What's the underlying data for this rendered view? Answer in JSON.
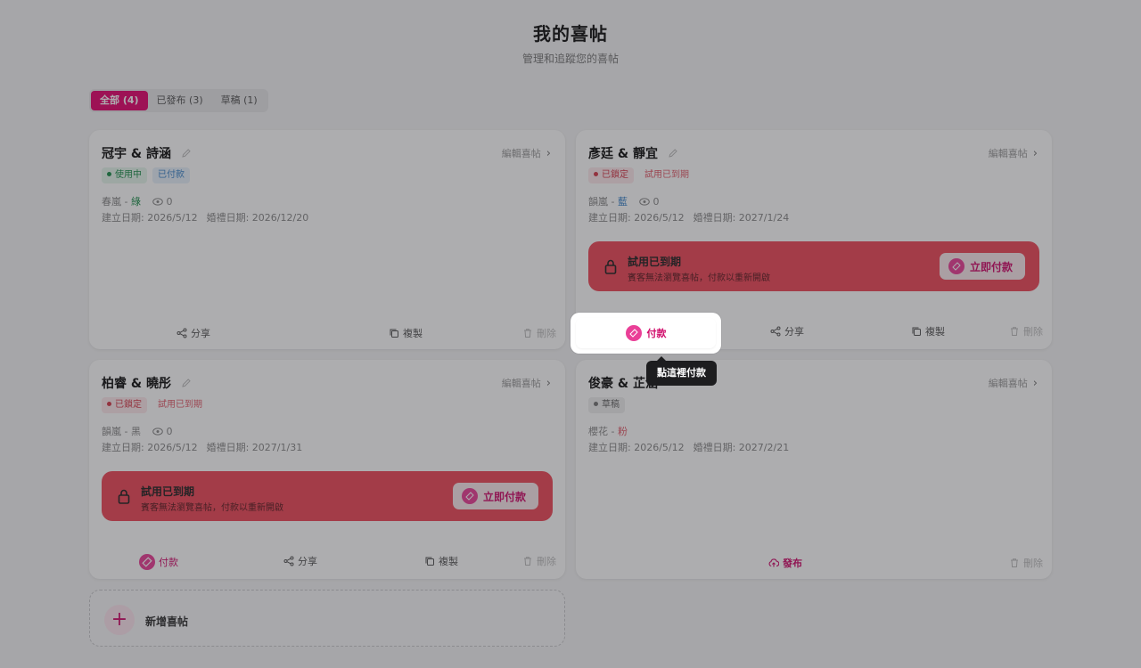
{
  "header": {
    "title": "我的喜帖",
    "subtitle": "管理和追蹤您的喜帖"
  },
  "tabs": [
    {
      "label": "全部 (4)",
      "active": true
    },
    {
      "label": "已發布 (3)",
      "active": false
    },
    {
      "label": "草稿 (1)",
      "active": false
    }
  ],
  "cards": [
    {
      "name": "冠宇 & 詩涵",
      "edit_label": "編輯喜帖",
      "badges": [
        "使用中",
        "已付款"
      ],
      "theme_name": "春嵐 - ",
      "theme_color": "綠",
      "views": "0",
      "created": "建立日期: 2026/5/12",
      "wedding": "婚禮日期: 2026/12/20",
      "actions": {
        "share": "分享",
        "copy": "複製",
        "delete": "刪除"
      }
    },
    {
      "name": "彥廷 & 靜宜",
      "edit_label": "編輯喜帖",
      "badges": [
        "已鎖定",
        "試用已到期"
      ],
      "theme_name": "韻嵐 - ",
      "theme_color": "藍",
      "views": "0",
      "created": "建立日期: 2026/5/12",
      "wedding": "婚禮日期: 2027/1/24",
      "alert": {
        "title": "試用已到期",
        "desc": "賓客無法瀏覽喜帖，付款以重新開啟",
        "button": "立即付款"
      },
      "actions": {
        "pay": "付款",
        "share": "分享",
        "copy": "複製",
        "delete": "刪除"
      }
    },
    {
      "name": "柏睿 & 曉彤",
      "edit_label": "編輯喜帖",
      "badges": [
        "已鎖定",
        "試用已到期"
      ],
      "theme_name": "韻嵐 - ",
      "theme_color": "黑",
      "views": "0",
      "created": "建立日期: 2026/5/12",
      "wedding": "婚禮日期: 2027/1/31",
      "alert": {
        "title": "試用已到期",
        "desc": "賓客無法瀏覽喜帖，付款以重新開啟",
        "button": "立即付款"
      },
      "actions": {
        "pay": "付款",
        "share": "分享",
        "copy": "複製",
        "delete": "刪除"
      }
    },
    {
      "name": "俊豪 & 芷涵",
      "edit_label": "編輯喜帖",
      "badges": [
        "草稿"
      ],
      "theme_name": "櫻花 - ",
      "theme_color": "粉",
      "created": "建立日期: 2026/5/12",
      "wedding": "婚禮日期: 2027/2/21",
      "actions": {
        "publish": "發布",
        "delete": "刪除"
      }
    }
  ],
  "new_card": {
    "label": "新增喜帖"
  },
  "tooltip": {
    "text": "點這裡付款"
  },
  "colors": {
    "brand": "#e6066f",
    "alert": "#ef4a5a",
    "success": "#1c8e4b",
    "info": "#3a84c9"
  }
}
